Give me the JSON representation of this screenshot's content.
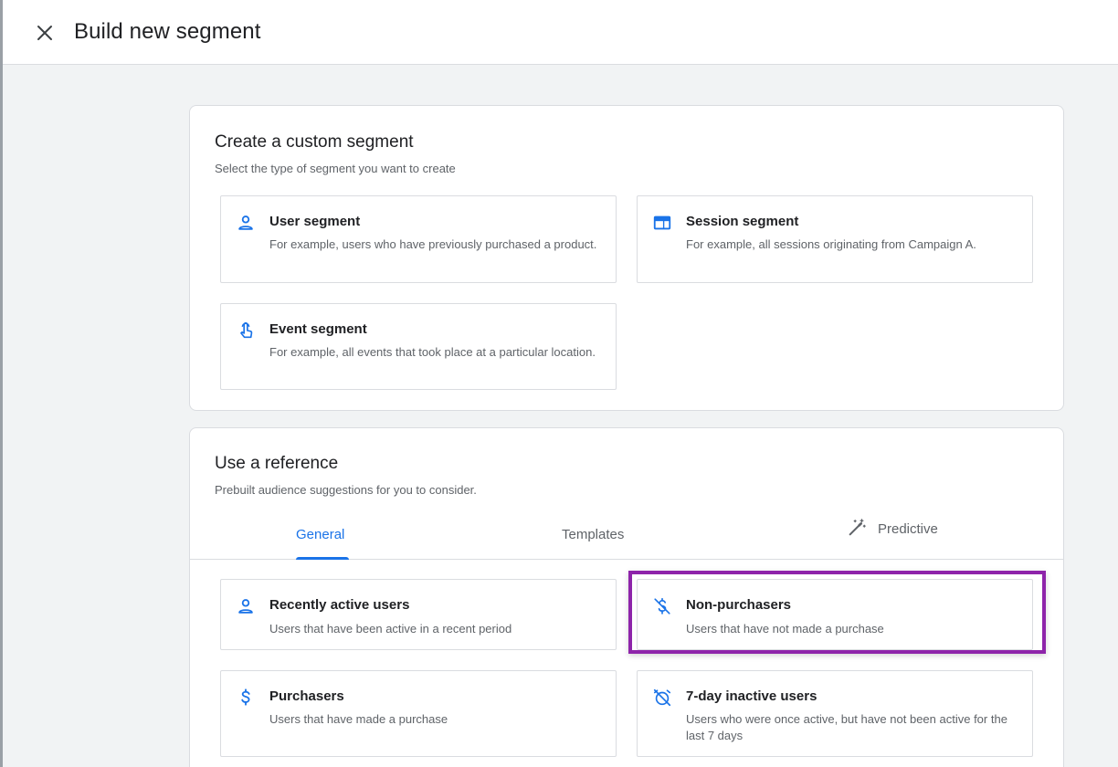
{
  "header": {
    "title": "Build new segment",
    "close_icon": "close-icon"
  },
  "custom": {
    "title": "Create a custom segment",
    "subtitle": "Select the type of segment you want to create",
    "options": [
      {
        "title": "User segment",
        "desc": "For example, users who have previously purchased a product.",
        "icon": "person-icon"
      },
      {
        "title": "Session segment",
        "desc": "For example, all sessions originating from Campaign A.",
        "icon": "session-icon"
      },
      {
        "title": "Event segment",
        "desc": "For example, all events that took place at a particular location.",
        "icon": "touch-icon"
      }
    ]
  },
  "reference": {
    "title": "Use a reference",
    "subtitle": "Prebuilt audience suggestions for you to consider.",
    "tabs": [
      {
        "label": "General",
        "active": true
      },
      {
        "label": "Templates",
        "active": false
      },
      {
        "label": "Predictive",
        "active": false,
        "icon": "magic-wand-icon"
      }
    ],
    "options": [
      {
        "title": "Recently active users",
        "desc": "Users that have been active in a recent period",
        "icon": "person-icon"
      },
      {
        "title": "Non-purchasers",
        "desc": "Users that have not made a purchase",
        "icon": "money-off-icon",
        "highlighted": true
      },
      {
        "title": "Purchasers",
        "desc": "Users that have made a purchase",
        "icon": "dollar-icon"
      },
      {
        "title": "7-day inactive users",
        "desc": "Users who were once active, but have not been active for the last 7 days",
        "icon": "alarm-off-icon"
      }
    ]
  },
  "colors": {
    "accent": "#1a73e8",
    "highlight": "#8e24aa",
    "text": "#202124",
    "muted": "#5f6368"
  }
}
